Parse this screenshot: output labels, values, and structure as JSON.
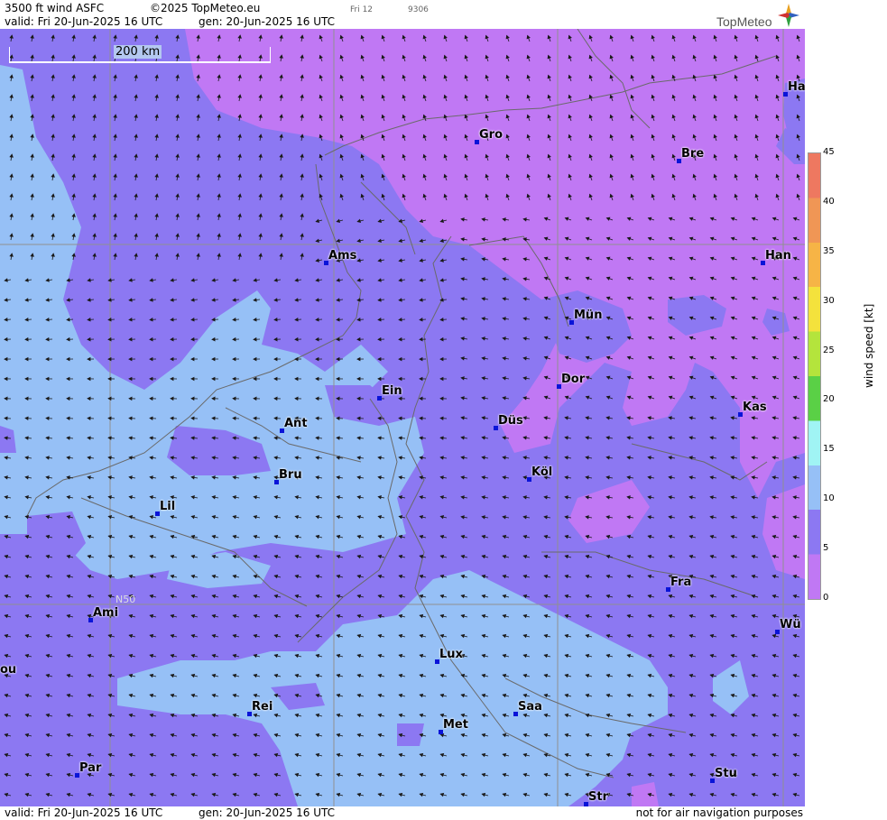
{
  "header": {
    "product": "3500 ft wind ASFC",
    "copyright": "©2025 TopMeteo.eu",
    "tab_hint": "Fri 12",
    "code": "9306",
    "valid": "valid:  Fri  20-Jun-2025  16 UTC",
    "gen": "gen: 20-Jun-2025 16 UTC",
    "logo": "TopMeteo"
  },
  "scale": {
    "label": "200 km"
  },
  "grid": {
    "lat_label": "N50"
  },
  "cities": [
    {
      "name": "Gro"
    },
    {
      "name": "Bre"
    },
    {
      "name": "Ha"
    },
    {
      "name": "Ams"
    },
    {
      "name": "Han"
    },
    {
      "name": "Mün"
    },
    {
      "name": "Dor"
    },
    {
      "name": "Ein"
    },
    {
      "name": "Kas"
    },
    {
      "name": "Ant"
    },
    {
      "name": "Düs"
    },
    {
      "name": "Bru"
    },
    {
      "name": "Köl"
    },
    {
      "name": "Lil"
    },
    {
      "name": "Fra"
    },
    {
      "name": "Ami"
    },
    {
      "name": "Wü"
    },
    {
      "name": "ou"
    },
    {
      "name": "Lux"
    },
    {
      "name": "Rei"
    },
    {
      "name": "Saa"
    },
    {
      "name": "Met"
    },
    {
      "name": "Stu"
    },
    {
      "name": "Par"
    },
    {
      "name": "Str"
    }
  ],
  "legend": {
    "title": "wind  speed  [kt]",
    "ticks": [
      "45",
      "40",
      "35",
      "30",
      "25",
      "20",
      "15",
      "10",
      "5",
      "0"
    ],
    "colors": [
      "#ee7860",
      "#f09655",
      "#f6b446",
      "#f4e23c",
      "#b4e43c",
      "#5ad046",
      "#a0f4f4",
      "#96c0f6",
      "#8c78f2",
      "#c078f4"
    ]
  },
  "footer": {
    "valid": "valid:  Fri  20-Jun-2025  16 UTC",
    "gen": "gen: 20-Jun-2025 16 UTC",
    "note": "not for air navigation purposes"
  }
}
